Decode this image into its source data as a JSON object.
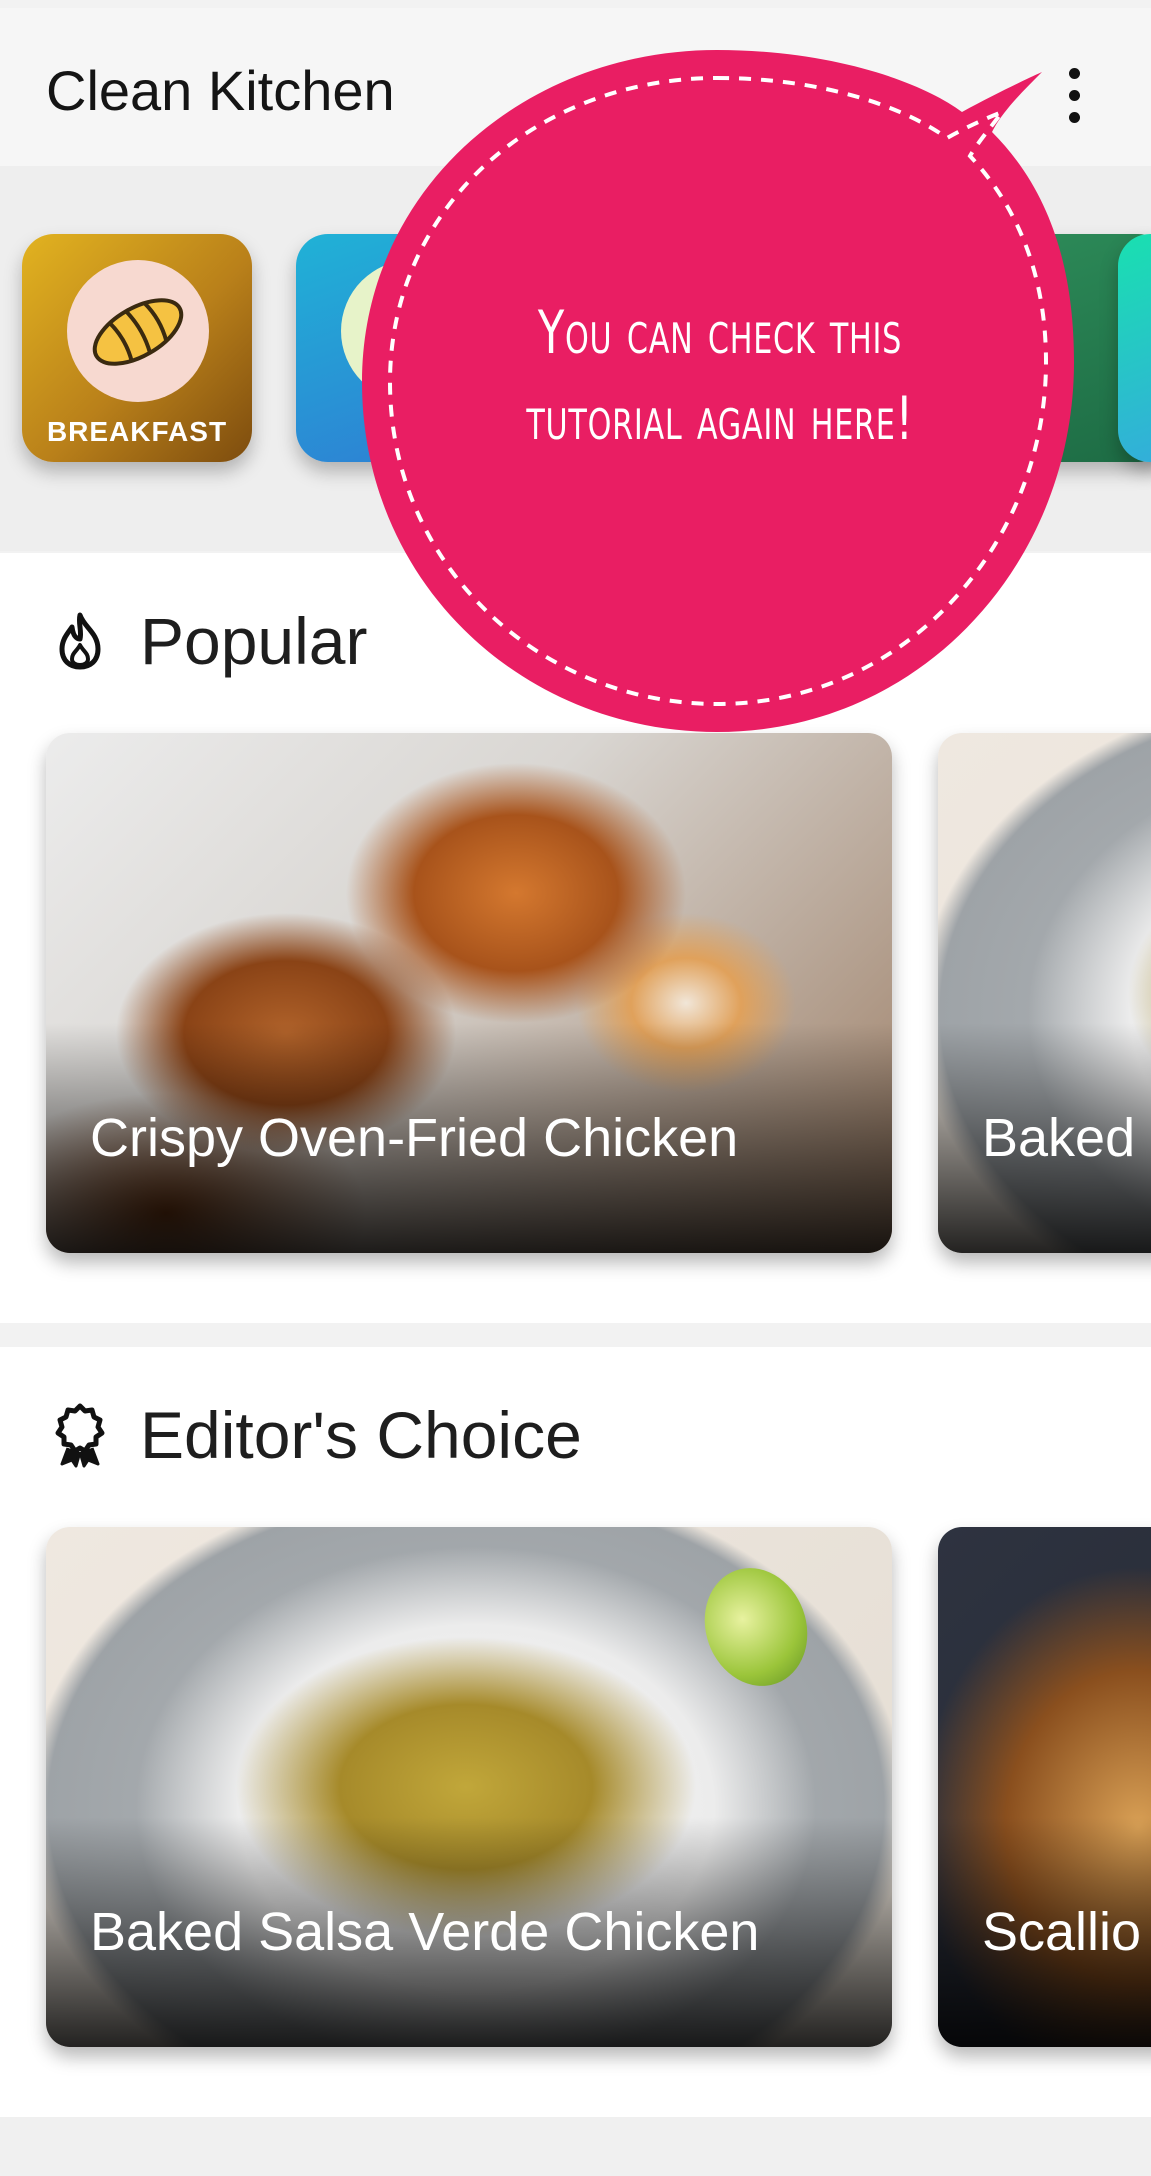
{
  "app_bar": {
    "title": "Clean Kitchen",
    "menu_icon": "more-vert-icon"
  },
  "categories": [
    {
      "label": "BREAKFAST",
      "icon": "croissant-icon",
      "color": "#c48a1a"
    },
    {
      "label": "",
      "icon": "category-icon",
      "color": "#2aa0d8"
    },
    {
      "label": "",
      "icon": "category-icon",
      "color": "#2e8d5a"
    },
    {
      "label": "",
      "icon": "category-icon",
      "color": "#19e0b0"
    }
  ],
  "popular": {
    "title": "Popular",
    "icon": "flame-icon",
    "cards": [
      {
        "title": "Crispy Oven-Fried Chicken"
      },
      {
        "title": "Baked"
      }
    ]
  },
  "editors_choice": {
    "title": "Editor's Choice",
    "icon": "award-icon",
    "cards": [
      {
        "title": "Baked Salsa Verde Chicken"
      },
      {
        "title": "Scallio"
      }
    ]
  },
  "tutorial_bubble": {
    "line1": "You can check this",
    "line2": "tutorial again here!",
    "color": "#e91e63"
  }
}
